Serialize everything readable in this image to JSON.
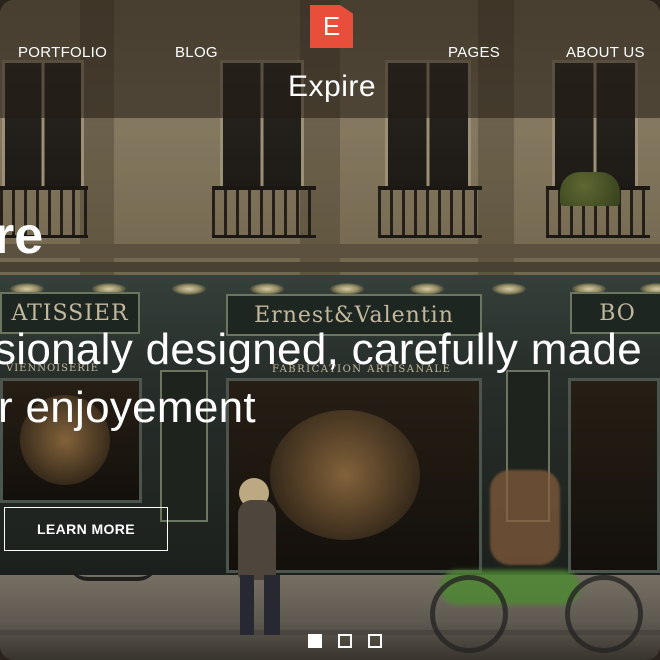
{
  "brand": {
    "logo_letter": "E",
    "name": "Expire",
    "accent": "#e84e3a"
  },
  "nav": {
    "left": [
      "PORTFOLIO",
      "BLOG"
    ],
    "right": [
      "PAGES",
      "ABOUT US"
    ]
  },
  "hero": {
    "title_fragment": "re",
    "subtitle_line1": "sionaly designed, carefully made",
    "subtitle_line2": "r enjoyement",
    "cta_label": "LEARN MORE"
  },
  "background_signs": {
    "patissier": "ATISSIER",
    "ernest": "Ernest&Valentin",
    "bo": "BO",
    "viennoiserie": "VIENNOISERIE",
    "fabrication": "FABRICATION ARTISANALE"
  },
  "slider": {
    "count": 3,
    "active_index": 0
  }
}
